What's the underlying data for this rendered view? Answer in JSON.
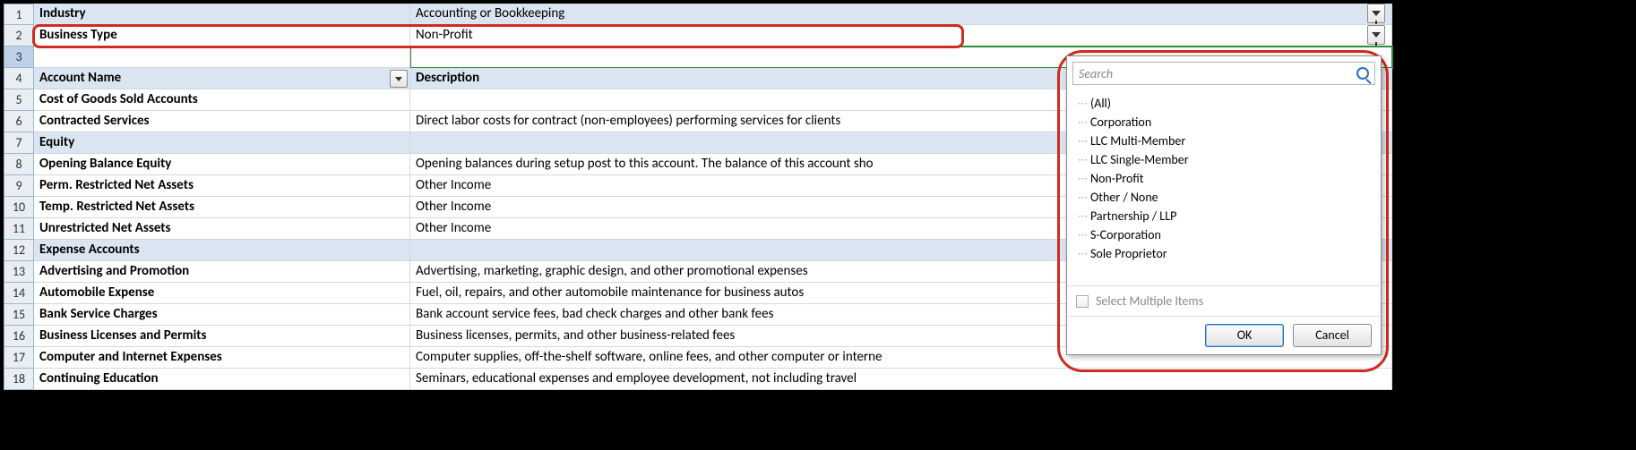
{
  "rows": [
    {
      "n": "1",
      "a": "Industry",
      "b": "Accounting or Bookkeeping",
      "shaded": true,
      "bold": true,
      "rightFilter": true
    },
    {
      "n": "2",
      "a": "Business Type",
      "b": "Non-Profit",
      "shaded": false,
      "bold": true,
      "rightFilter": true,
      "redBox": true
    },
    {
      "n": "3",
      "a": "",
      "b": "",
      "shaded": false,
      "bold": false,
      "selected": true
    },
    {
      "n": "4",
      "a": "Account Name",
      "b": "Description",
      "shaded": true,
      "bold": true,
      "header": true,
      "ddA": true
    },
    {
      "n": "5",
      "a": "Cost of Goods Sold Accounts",
      "b": "",
      "shaded": false,
      "bold": true
    },
    {
      "n": "6",
      "a": "Contracted Services",
      "b": "Direct labor costs for contract (non-employees) performing services for clients",
      "shaded": false,
      "bold": true
    },
    {
      "n": "7",
      "a": "Equity",
      "b": "",
      "shaded": true,
      "bold": true
    },
    {
      "n": "8",
      "a": "Opening Balance Equity",
      "b": "Opening balances during setup post to this account. The balance of this account sho",
      "shaded": false,
      "bold": true
    },
    {
      "n": "9",
      "a": "Perm. Restricted Net Assets",
      "b": "Other Income",
      "shaded": false,
      "bold": true
    },
    {
      "n": "10",
      "a": "Temp. Restricted Net Assets",
      "b": "Other Income",
      "shaded": false,
      "bold": true
    },
    {
      "n": "11",
      "a": "Unrestricted Net Assets",
      "b": "Other Income",
      "shaded": false,
      "bold": true
    },
    {
      "n": "12",
      "a": "Expense Accounts",
      "b": "",
      "shaded": true,
      "bold": true
    },
    {
      "n": "13",
      "a": "Advertising and Promotion",
      "b": "Advertising, marketing, graphic design, and other promotional expenses",
      "shaded": false,
      "bold": true
    },
    {
      "n": "14",
      "a": "Automobile Expense",
      "b": "Fuel, oil, repairs, and other automobile maintenance for business autos",
      "shaded": false,
      "bold": true
    },
    {
      "n": "15",
      "a": "Bank Service Charges",
      "b": "Bank account service fees, bad check charges and other bank fees",
      "shaded": false,
      "bold": true
    },
    {
      "n": "16",
      "a": "Business Licenses and Permits",
      "b": "Business licenses, permits, and other business-related fees",
      "shaded": false,
      "bold": true
    },
    {
      "n": "17",
      "a": "Computer and Internet Expenses",
      "b": "Computer supplies, off-the-shelf software, online fees, and other computer or interne",
      "shaded": false,
      "bold": true
    },
    {
      "n": "18",
      "a": "Continuing Education",
      "b": "Seminars, educational expenses and employee development, not including travel",
      "shaded": false,
      "bold": true
    }
  ],
  "popup": {
    "searchPlaceholder": "Search",
    "items": [
      "(All)",
      "Corporation",
      "LLC Multi-Member",
      "LLC Single-Member",
      "Non-Profit",
      "Other / None",
      "Partnership / LLP",
      "S-Corporation",
      "Sole Proprietor"
    ],
    "multiLabel": "Select Multiple Items",
    "ok": "OK",
    "cancel": "Cancel"
  }
}
